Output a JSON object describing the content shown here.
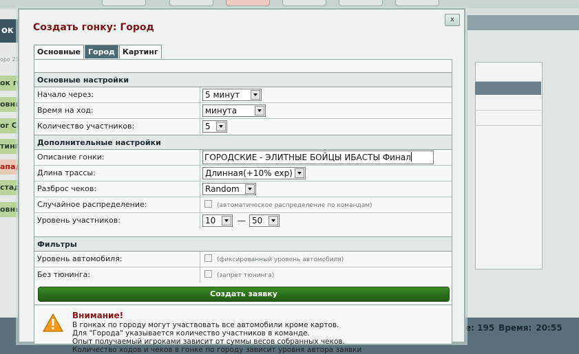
{
  "background": {
    "left_panel_title": "ок",
    "left_small_text": "оро 25",
    "left_items": [
      "ок го",
      "овны",
      "or Ci",
      "тинг",
      "апад",
      "стадь",
      "овны"
    ],
    "stats": {
      "race_label": "е: 195",
      "time_label": "Время:",
      "time_value": "20:55"
    }
  },
  "dialog": {
    "title": "Создать гонку: Город",
    "close_label": "x",
    "tabs": [
      {
        "label": "Основные",
        "active": false
      },
      {
        "label": "Город",
        "active": true
      },
      {
        "label": "Картинг",
        "active": false
      }
    ],
    "basic_section": {
      "heading": "Основные настройки",
      "start_in": {
        "label": "Начало через:",
        "value": "5 минут"
      },
      "move_time": {
        "label": "Время на ход:",
        "value": "минута"
      },
      "participants": {
        "label": "Количество участников:",
        "value": "5"
      }
    },
    "extra_section": {
      "heading": "Дополнительные настройки",
      "description": {
        "label": "Описание гонки:",
        "value": "ГОРОДСКИЕ - ЭЛИТНЫЕ БОЙЦЫ ИБАСТЫ  Финал"
      },
      "track_length": {
        "label": "Длина трассы:",
        "value": "Длинная(+10% exp)"
      },
      "check_spread": {
        "label": "Разброс чеков:",
        "value": "Random"
      },
      "random_distribution": {
        "label": "Случайное распределение:",
        "note": "(автоматическое распределение по командам)",
        "checked": false
      },
      "level": {
        "label": "Уровень участников:",
        "min": "10",
        "separator": "—",
        "max": "50"
      }
    },
    "filters_section": {
      "heading": "Фильтры",
      "car_level": {
        "label": "Уровень автомобиля:",
        "note": "(фиксированный уровень автомобиля)",
        "checked": false
      },
      "no_tuning": {
        "label": "Без тюнинга:",
        "note": "(запрет тюнинга)",
        "checked": false
      }
    },
    "submit_label": "Создать заявку",
    "warning": {
      "title": "Внимание!",
      "lines": [
        "В гонках по городу могут участвовать все автомобили кроме картов.",
        "Для \"Города\" указывается количество участников в команде.",
        "Опыт получаемый игроками зависит от суммы весов собранных чеков.",
        "Количество ходов и чеков в гонке по городу зависит уровня автора заявки"
      ]
    }
  },
  "colors": {
    "title_red": "#7a1416",
    "active_tab": "#4d6b73",
    "submit_green": "#2f7a1f"
  }
}
